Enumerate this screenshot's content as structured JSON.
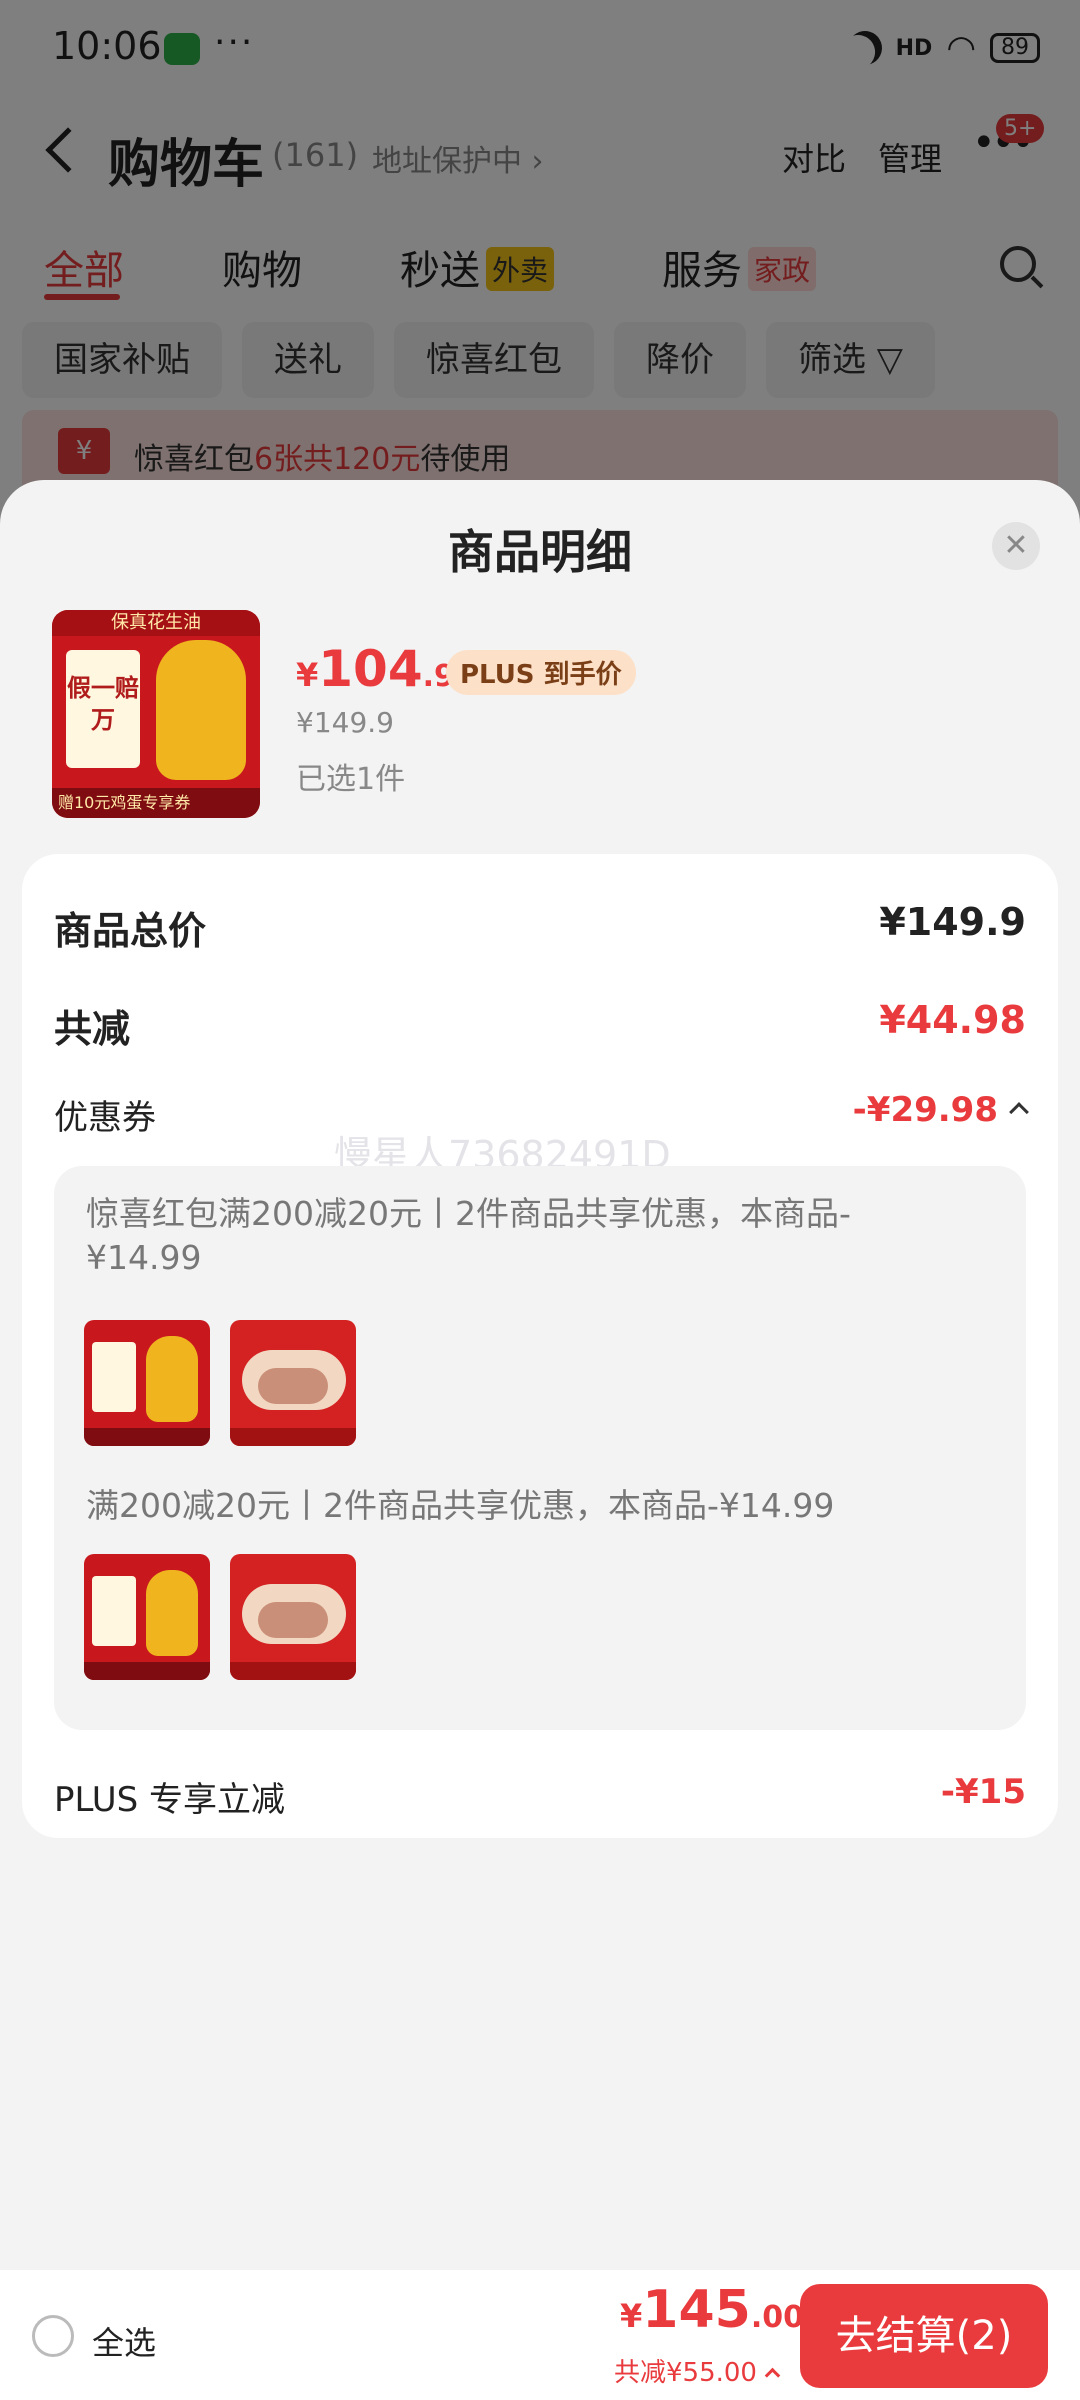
{
  "status_bar": {
    "time": "10:06",
    "dots": "···",
    "signal": "HD",
    "battery": "89"
  },
  "navbar": {
    "title": "购物车",
    "count": "(161)",
    "address_protect": "地址保护中 ›",
    "compare": "对比",
    "manage": "管理",
    "more_badge": "5+"
  },
  "tabs": [
    {
      "label": "全部"
    },
    {
      "label": "购物"
    },
    {
      "label": "秒送",
      "tag": "外卖"
    },
    {
      "label": "服务",
      "tag": "家政"
    }
  ],
  "chips": [
    "国家补贴",
    "送礼",
    "惊喜红包",
    "降价",
    "筛选 ▽"
  ],
  "promo": {
    "icon": "¥",
    "prefix": "惊喜红包",
    "highlight": "6张共120元",
    "suffix": "待使用"
  },
  "sheet": {
    "title": "商品明细",
    "close_icon": "✕",
    "product": {
      "image_band": "保真花生油",
      "image_label": "假一赔万",
      "image_footer": "赠10元鸡蛋专享券",
      "price_currency": "¥",
      "price_int": "104",
      "price_dec": ".92",
      "price_tag": "PLUS 到手价",
      "original_price": "¥149.9",
      "selected_qty": "已选1件"
    },
    "summary": {
      "total_label": "商品总价",
      "total_value": "¥149.9",
      "discount_label": "共减",
      "discount_value": "¥44.98",
      "coupon_label": "优惠券",
      "coupon_value": "-¥29.98",
      "watermark": "慢星人73682491D",
      "coupon_details": [
        {
          "text": "惊喜红包满200减20元丨2件商品共享优惠，本商品-¥14.99"
        },
        {
          "text": "满200减20元丨2件商品共享优惠，本商品-¥14.99"
        }
      ],
      "plus_label": "PLUS 专享立减",
      "plus_value": "-¥15"
    }
  },
  "bottom_bar": {
    "select_all": "全选",
    "total_currency": "¥",
    "total_int": "145",
    "total_dec": ".00",
    "total_saved": "共减¥55.00",
    "checkout": "去结算(2)"
  },
  "colors": {
    "accent": "#e93b3d",
    "sheet_bg": "#f3f3f3",
    "plus_tag_bg": "#fde0c8"
  }
}
